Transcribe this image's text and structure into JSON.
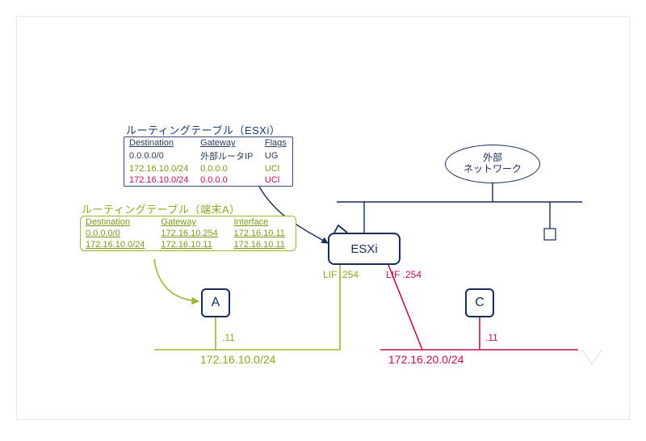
{
  "tables": {
    "esxi": {
      "title": "ルーティングテーブル（ESXi）",
      "headers": {
        "c0": "Destination",
        "c1": "Gateway",
        "c2": "Flags"
      },
      "rows": [
        {
          "c0": "0.0.0.0/0",
          "c1": "外部ルータIP",
          "c2": "UG"
        },
        {
          "c0": "172.16.10.0/24",
          "c1": "0.0.0.0",
          "c2": "UCl"
        },
        {
          "c0": "172.16.10.0/24",
          "c1": "0.0.0.0",
          "c2": "UCl"
        }
      ]
    },
    "host_a": {
      "title": "ルーティングテーブル（端末A）",
      "headers": {
        "c0": "Destination",
        "c1": "Gateway",
        "c2": "Interface"
      },
      "rows": [
        {
          "c0": "0.0.0.0/0",
          "c1": "172.16.10.254",
          "c2": "172.16.10.11"
        },
        {
          "c0": "172.16.10.0/24",
          "c1": "172.16.10.11",
          "c2": "172.16.10.11"
        }
      ]
    }
  },
  "nodes": {
    "esxi": "ESXi",
    "external_l1": "外部",
    "external_l2": "ネットワーク",
    "host_a": "A",
    "host_c": "C"
  },
  "labels": {
    "lif_green": "LIF .254",
    "lif_red": "LIF .254",
    "ip_a": ".11",
    "ip_c": ".11",
    "subnet_green": "172.16.10.0/24",
    "subnet_red": "172.16.20.0/24"
  },
  "colors": {
    "navy": "#1a2a5a",
    "olive": "#98b830",
    "olive_text": "#88a820",
    "magenta": "#c01050"
  }
}
